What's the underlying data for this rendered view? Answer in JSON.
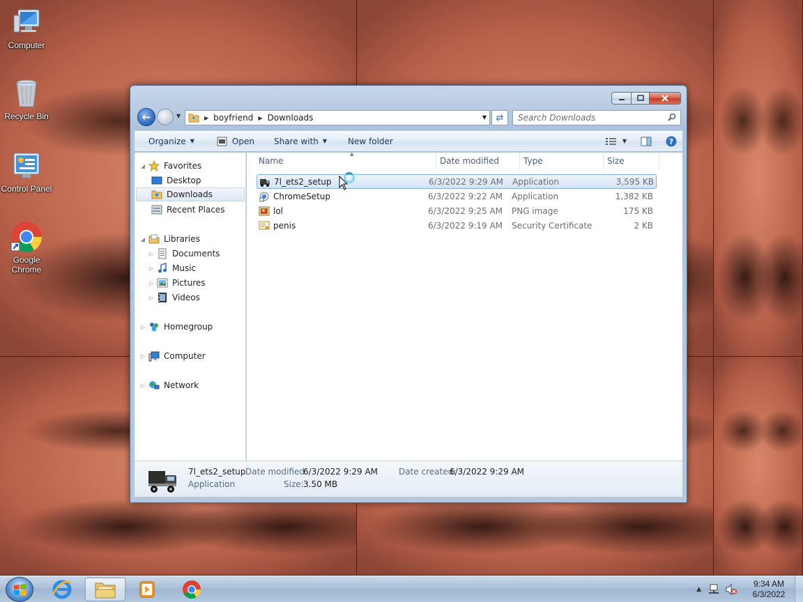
{
  "desktop": {
    "icons": [
      {
        "label": "Computer"
      },
      {
        "label": "Recycle Bin"
      },
      {
        "label": "Control Panel"
      },
      {
        "label": "Google Chrome"
      }
    ]
  },
  "window": {
    "breadcrumb": [
      "boyfriend",
      "Downloads"
    ],
    "search_placeholder": "Search Downloads",
    "toolbar": {
      "organize": "Organize",
      "open": "Open",
      "share_with": "Share with",
      "new_folder": "New folder"
    },
    "nav": {
      "favorites": "Favorites",
      "desktop": "Desktop",
      "downloads": "Downloads",
      "recent_places": "Recent Places",
      "libraries": "Libraries",
      "documents": "Documents",
      "music": "Music",
      "pictures": "Pictures",
      "videos": "Videos",
      "homegroup": "Homegroup",
      "computer": "Computer",
      "network": "Network",
      "selected": "downloads"
    },
    "columns": {
      "name": "Name",
      "date": "Date modified",
      "type": "Type",
      "size": "Size"
    },
    "files": [
      {
        "name": "7l_ets2_setup",
        "date": "6/3/2022 9:29 AM",
        "type": "Application",
        "size": "3,595 KB",
        "icon": "truck-app-icon",
        "selected": true
      },
      {
        "name": "ChromeSetup",
        "date": "6/3/2022 9:22 AM",
        "type": "Application",
        "size": "1,382 KB",
        "icon": "installer-icon",
        "selected": false
      },
      {
        "name": "lol",
        "date": "6/3/2022 9:25 AM",
        "type": "PNG image",
        "size": "175 KB",
        "icon": "image-icon",
        "selected": false
      },
      {
        "name": "penis",
        "date": "6/3/2022 9:19 AM",
        "type": "Security Certificate",
        "size": "2 KB",
        "icon": "certificate-icon",
        "selected": false
      }
    ],
    "details": {
      "name": "7l_ets2_setup",
      "kind": "Application",
      "modified_label": "Date modified:",
      "modified": "6/3/2022 9:29 AM",
      "created_label": "Date created:",
      "created": "6/3/2022 9:29 AM",
      "size_label": "Size:",
      "size": "3.50 MB"
    }
  },
  "taskbar": {
    "time": "9:34 AM",
    "date": "6/3/2022",
    "pinned": [
      "internet-explorer-icon",
      "windows-explorer-icon",
      "media-player-icon",
      "chrome-icon"
    ]
  },
  "colors": {
    "selection": "#d3e4f8",
    "accent": "#2b64b6",
    "close_button": "#c23c22"
  }
}
